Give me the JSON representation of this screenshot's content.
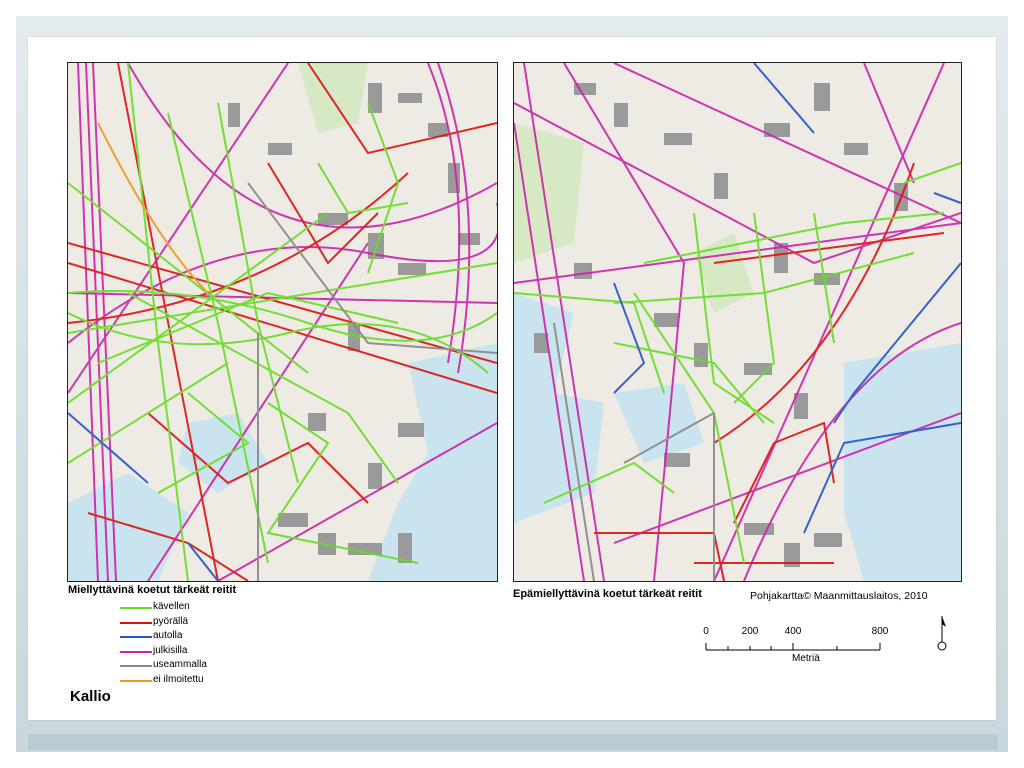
{
  "left_map_title": "Miellyttävinä koetut tärkeät reitit",
  "right_map_title": "Epämiellyttävinä koetut tärkeät reitit",
  "credit": "Pohjakartta© Maanmittauslaitos, 2010",
  "area_name": "Kallio",
  "legend": [
    {
      "label": "kävellen",
      "color": "#66dd22"
    },
    {
      "label": "pyörällä",
      "color": "#dd1111"
    },
    {
      "label": "autolla",
      "color": "#2255cc"
    },
    {
      "label": "julkisilla",
      "color": "#cc22aa"
    },
    {
      "label": "useammalla",
      "color": "#888888"
    },
    {
      "label": "ei ilmoitettu",
      "color": "#ee9922"
    }
  ],
  "scale": {
    "ticks": [
      "0",
      "200",
      "400",
      "800"
    ],
    "unit": "Metriä"
  },
  "colors": {
    "water": "#c9e4ef",
    "land": "#eeeae4",
    "building": "#9a9a9a",
    "park": "#d7e9c4"
  }
}
